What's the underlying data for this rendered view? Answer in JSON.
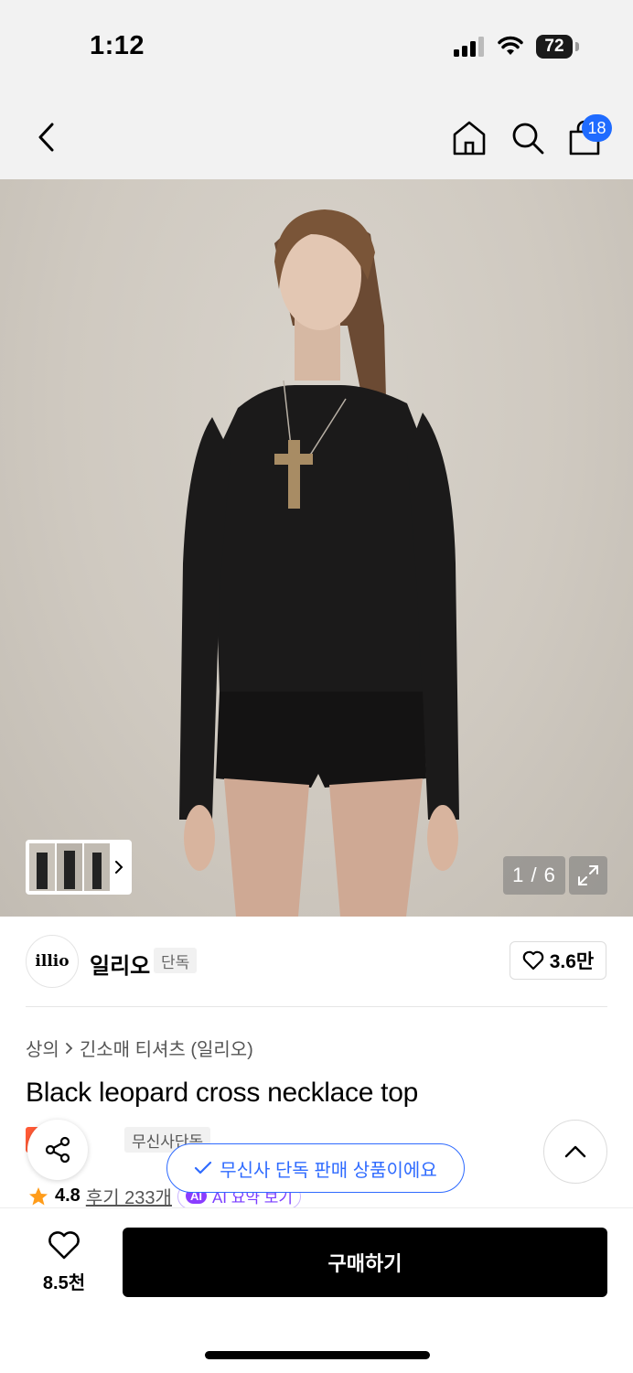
{
  "status_bar": {
    "time": "1:12",
    "battery": "72"
  },
  "nav": {
    "cart_count": "18"
  },
  "gallery": {
    "counter": "1 / 6"
  },
  "brand": {
    "logo_text": "illio",
    "name": "일리오",
    "tag": "단독",
    "likes": "3.6만"
  },
  "breadcrumb": {
    "category": "상의",
    "subcategory": "긴소매 티셔츠 (일리오)"
  },
  "product": {
    "title": "Black leopard cross necklace top",
    "tags": [
      "세일",
      "무신사단독"
    ],
    "rating": "4.8",
    "reviews": "후기 233개",
    "ai_badge": "AI",
    "ai_summary": "AI 요약 보기"
  },
  "toast": {
    "text": "무신사 단독 판매 상품이에요"
  },
  "bottom_bar": {
    "wish_count": "8.5천",
    "buy_label": "구매하기"
  },
  "colors": {
    "accent_blue": "#2f6bff",
    "sale": "#ff5a36",
    "buy_button": "#000000"
  }
}
